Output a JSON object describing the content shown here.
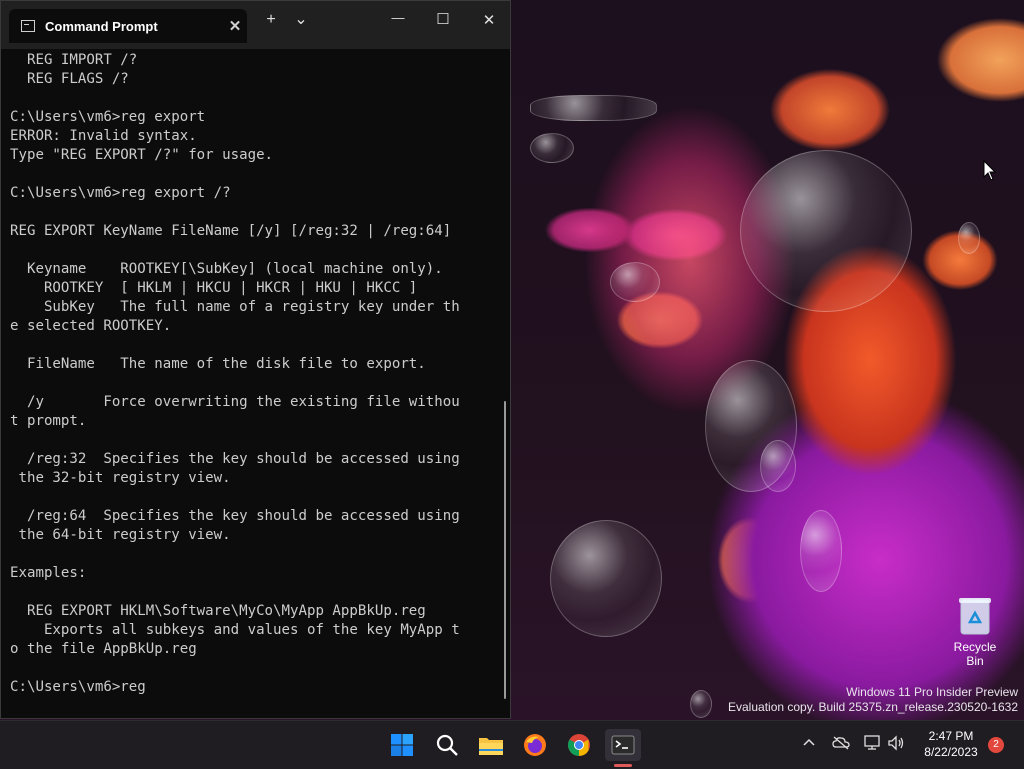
{
  "window": {
    "tab_title": "Command Prompt",
    "tab_close_glyph": "✕",
    "new_tab_glyph": "+",
    "dropdown_glyph": "⌄",
    "minimize_glyph": "—",
    "maximize_glyph": "☐",
    "close_glyph": "✕"
  },
  "console": {
    "text": "  REG IMPORT /?\n  REG FLAGS /?\n\nC:\\Users\\vm6>reg export\nERROR: Invalid syntax.\nType \"REG EXPORT /?\" for usage.\n\nC:\\Users\\vm6>reg export /?\n\nREG EXPORT KeyName FileName [/y] [/reg:32 | /reg:64]\n\n  Keyname    ROOTKEY[\\SubKey] (local machine only).\n    ROOTKEY  [ HKLM | HKCU | HKCR | HKU | HKCC ]\n    SubKey   The full name of a registry key under th\ne selected ROOTKEY.\n\n  FileName   The name of the disk file to export.\n\n  /y       Force overwriting the existing file withou\nt prompt.\n\n  /reg:32  Specifies the key should be accessed using\n the 32-bit registry view.\n\n  /reg:64  Specifies the key should be accessed using\n the 64-bit registry view.\n\nExamples:\n\n  REG EXPORT HKLM\\Software\\MyCo\\MyApp AppBkUp.reg\n    Exports all subkeys and values of the key MyApp t\no the file AppBkUp.reg\n\nC:\\Users\\vm6>reg"
  },
  "desktop": {
    "recycle_bin_label": "Recycle Bin",
    "watermark_line1": "Windows 11 Pro Insider Preview",
    "watermark_line2": "Evaluation copy. Build 25375.zn_release.230520-1632"
  },
  "taskbar": {
    "time": "2:47 PM",
    "date": "8/22/2023",
    "notification_count": "2",
    "pinned": [
      "start-icon",
      "search-icon",
      "file-explorer-icon",
      "firefox-icon",
      "chrome-icon",
      "terminal-icon"
    ]
  },
  "colors": {
    "console_bg": "#0c0c0c",
    "console_text": "#cccccc",
    "titlebar_bg": "#202020",
    "taskbar_bg": "#1f1c22",
    "windows_blue": "#1e90ff",
    "notification_red": "#e2483d"
  }
}
